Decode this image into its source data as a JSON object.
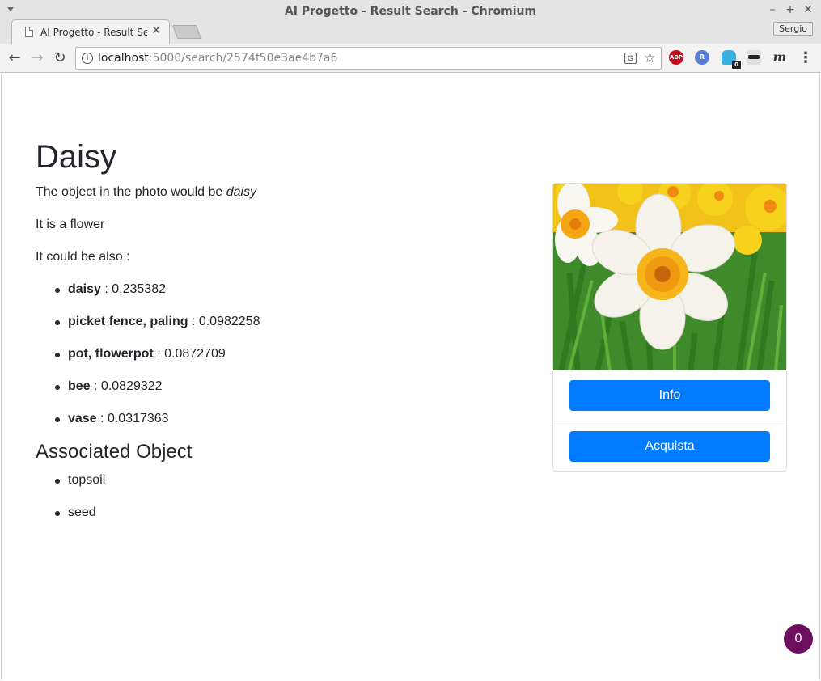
{
  "window": {
    "title": "AI Progetto - Result Search - Chromium",
    "minimize": "–",
    "maximize": "+",
    "close": "✕"
  },
  "tab": {
    "title": "AI Progetto - Result Search",
    "close": "✕"
  },
  "profile": {
    "name": "Sergio"
  },
  "toolbar": {
    "back": "←",
    "forward": "→",
    "reload": "↻",
    "url_host": "localhost",
    "url_rest": ":5000/search/2574f50e3ae4b7a6",
    "star": "☆",
    "menu": "⋮"
  },
  "extensions": {
    "abp": "ABP",
    "r": "R",
    "ghost_badge": "0",
    "m": "m"
  },
  "page": {
    "title": "Daisy",
    "object_prefix": "The object in the photo would be ",
    "object_name": "daisy",
    "category_text": "It is a flower",
    "alternatives_label": "It could be also :",
    "alternatives": [
      {
        "name": "daisy",
        "score": "0.235382"
      },
      {
        "name": "picket fence, paling",
        "score": "0.0982258"
      },
      {
        "name": "pot, flowerpot",
        "score": "0.0872709"
      },
      {
        "name": "bee",
        "score": "0.0829322"
      },
      {
        "name": "vase",
        "score": "0.0317363"
      }
    ],
    "associated_heading": "Associated Object",
    "associated": [
      "topsoil",
      "seed"
    ]
  },
  "card": {
    "info_label": "Info",
    "buy_label": "Acquista"
  },
  "fab": {
    "count": "0"
  },
  "colors": {
    "primary": "#007bff",
    "text": "#212529",
    "fab": "#6b0f5e"
  }
}
